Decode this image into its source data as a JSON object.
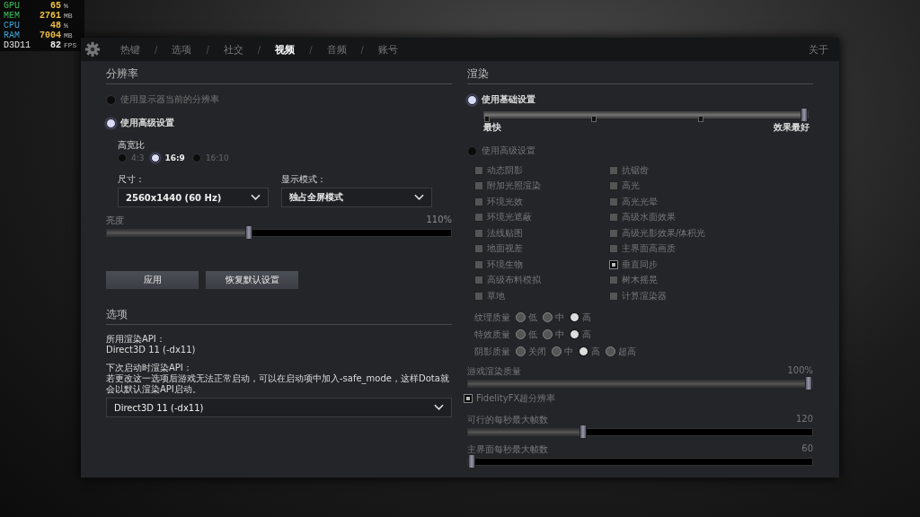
{
  "overlay": {
    "stats": [
      {
        "label": "GPU",
        "value": "65",
        "unit": "%",
        "color": "#3fbf5f"
      },
      {
        "label": "MEM",
        "value": "2761",
        "unit": "MB",
        "color": "#3fbf5f"
      },
      {
        "label": "CPU",
        "value": "48",
        "unit": "%",
        "color": "#3aa7d8"
      },
      {
        "label": "RAM",
        "value": "7004",
        "unit": "MB",
        "color": "#3aa7d8"
      },
      {
        "label": "D3D11",
        "value": "82",
        "unit": "FPS",
        "color": "#e8e8e8"
      }
    ]
  },
  "tabs": [
    {
      "label": "热键",
      "selected": false
    },
    {
      "label": "选项",
      "selected": false
    },
    {
      "label": "社交",
      "selected": false
    },
    {
      "label": "视频",
      "selected": true
    },
    {
      "label": "音频",
      "selected": false
    },
    {
      "label": "账号",
      "selected": false
    }
  ],
  "separators": [
    "/",
    "/",
    "/",
    "/",
    "/"
  ],
  "about": "关于",
  "resolution": {
    "title": "分辨率",
    "modes": [
      {
        "label": "使用显示器当前的分辨率",
        "selected": false
      },
      {
        "label": "使用高级设置",
        "selected": true
      }
    ],
    "aspect_label": "高宽比",
    "aspects": [
      {
        "label": "4:3",
        "selected": false
      },
      {
        "label": "16:9",
        "selected": true
      },
      {
        "label": "16:10",
        "selected": false
      }
    ],
    "size": {
      "label": "尺寸：",
      "value": "2560x1440 (60 Hz)"
    },
    "display_mode": {
      "label": "显示模式：",
      "value": "独占全屏模式"
    },
    "brightness": {
      "label": "亮度",
      "reading": "110%",
      "level": 0.41
    },
    "buttons": [
      "应用",
      "恢复默认设置"
    ]
  },
  "options": {
    "title": "选项",
    "current_label": "所用渲染API：",
    "current_value": "Direct3D 11 (-dx11)",
    "next_label": "下次启动时渲染API：",
    "note": "若更改这一选项后游戏无法正常启动，可以在启动项中加入-safe_mode，这样Dota就会以默认渲染API启动。",
    "next_value": "Direct3D 11 (-dx11)"
  },
  "render": {
    "title": "渲染",
    "basic": {
      "label": "使用基础设置",
      "selected": true,
      "level": 1,
      "low_label": "最快",
      "high_label": "效果最好"
    },
    "advanced": {
      "label": "使用高级设置",
      "selected": false,
      "disabled": true,
      "checkboxes_left": [
        {
          "label": "动态阴影",
          "checked": false
        },
        {
          "label": "附加光照渲染",
          "checked": false
        },
        {
          "label": "环境光效",
          "checked": false
        },
        {
          "label": "环境光遮蔽",
          "checked": false
        },
        {
          "label": "法线贴图",
          "checked": false
        },
        {
          "label": "地面视差",
          "checked": false
        },
        {
          "label": "环境生物",
          "checked": false
        },
        {
          "label": "高级布料模拟",
          "checked": false
        },
        {
          "label": "草地",
          "checked": false
        }
      ],
      "checkboxes_right": [
        {
          "label": "抗锯齿",
          "checked": false
        },
        {
          "label": "高光",
          "checked": false
        },
        {
          "label": "高光光晕",
          "checked": false
        },
        {
          "label": "高级水面效果",
          "checked": false
        },
        {
          "label": "高级光影效果/体积光",
          "checked": false
        },
        {
          "label": "主界面高画质",
          "checked": false
        },
        {
          "label": "垂直同步",
          "checked": true
        },
        {
          "label": "树木摇晃",
          "checked": false
        },
        {
          "label": "计算渲染器",
          "checked": false
        }
      ],
      "qualities": [
        {
          "label": "纹理质量",
          "options": [
            {
              "label": "低",
              "selected": false
            },
            {
              "label": "中",
              "selected": false
            },
            {
              "label": "高",
              "selected": true
            }
          ]
        },
        {
          "label": "特效质量",
          "options": [
            {
              "label": "低",
              "selected": false
            },
            {
              "label": "中",
              "selected": false
            },
            {
              "label": "高",
              "selected": true
            }
          ]
        },
        {
          "label": "阴影质量",
          "options": [
            {
              "label": "关闭",
              "selected": false
            },
            {
              "label": "中",
              "selected": false
            },
            {
              "label": "高",
              "selected": true
            },
            {
              "label": "超高",
              "selected": false
            }
          ]
        }
      ],
      "render_quality": {
        "label": "游戏渲染质量",
        "reading": "100%",
        "level": 1
      },
      "fsr": {
        "label": "FidelityFX超分辨率",
        "checked": true
      },
      "max_fps": {
        "label": "可行的每秒最大帧数",
        "reading": "120",
        "level": 0.33
      },
      "menu_fps": {
        "label": "主界面每秒最大帧数",
        "reading": "60",
        "level": 0
      }
    }
  }
}
